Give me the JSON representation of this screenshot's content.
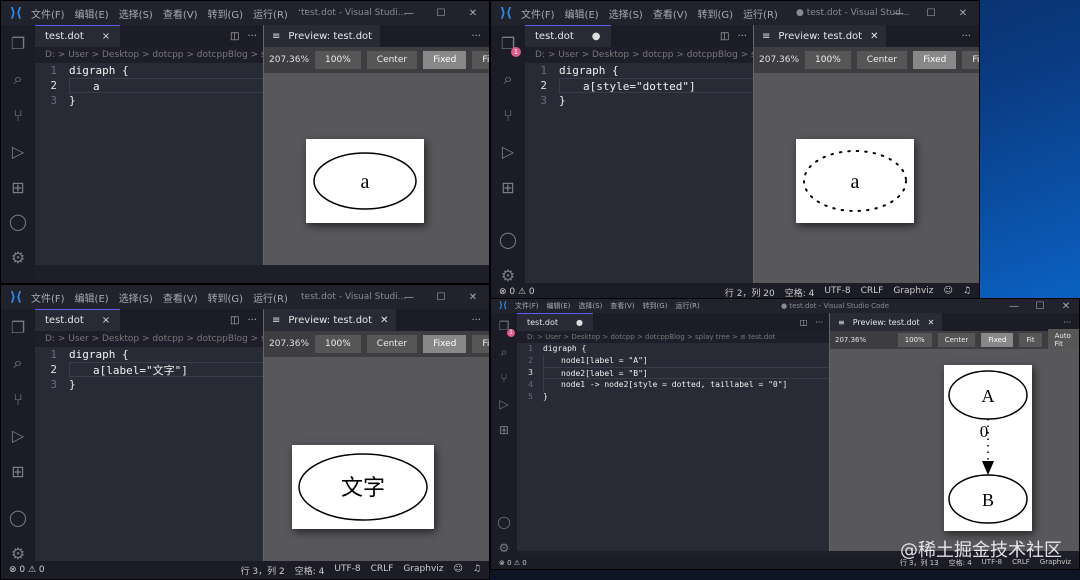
{
  "menu": [
    "文件(F)",
    "编辑(E)",
    "选择(S)",
    "查看(V)",
    "转到(G)",
    "运行(R)",
    "···"
  ],
  "windows": [
    {
      "title": "test.dot - Visual Studi...",
      "tab": "test.dot",
      "tab_status": "×",
      "breadcrumb": "D: > User > Desktop > dotcpp > dotcppBlog > splay tr",
      "code": [
        "digraph {",
        "a",
        "}"
      ],
      "cursor_line": 2,
      "preview_tab": "Preview: test.dot",
      "zoom": "207.36%",
      "buttons": [
        "100%",
        "Center",
        "Fixed",
        "Fit"
      ],
      "node_label": "a",
      "status_left": "",
      "status_right": []
    },
    {
      "title": "● test.dot - Visual Stud...",
      "tab": "test.dot",
      "tab_status": "●",
      "breadcrumb": "D: > User > Desktop > dotcpp > dotcppBlog > splay tr",
      "code": [
        "digraph {",
        "a[style=\"dotted\"]",
        "}"
      ],
      "cursor_line": 2,
      "preview_tab": "Preview: test.dot",
      "zoom": "207.36%",
      "buttons": [
        "100%",
        "Center",
        "Fixed",
        "Fit"
      ],
      "node_label": "a",
      "status_left": "⊗ 0 ⚠ 0",
      "status_right": [
        "行 2，列 20",
        "空格: 4",
        "UTF-8",
        "CRLF",
        "Graphviz"
      ]
    },
    {
      "title": "test.dot - Visual Studi...",
      "tab": "test.dot",
      "tab_status": "×",
      "breadcrumb": "D: > User > Desktop > dotcpp > dotcppBlog > splay tr",
      "code": [
        "digraph {",
        "a[label=\"文字\"]",
        "}"
      ],
      "cursor_line": 2,
      "preview_tab": "Preview: test.dot",
      "zoom": "207.36%",
      "buttons": [
        "100%",
        "Center",
        "Fixed",
        "Fit"
      ],
      "node_label": "文字",
      "status_left": "⊗ 0 ⚠ 0",
      "status_right": [
        "行 3，列 2",
        "空格: 4",
        "UTF-8",
        "CRLF",
        "Graphviz"
      ]
    },
    {
      "title": "● test.dot - Visual Studio Code",
      "tab": "test.dot",
      "tab_status": "●",
      "breadcrumb": "D: > User > Desktop > dotcpp > dotcppBlog > splay tree > ≡ test.dot",
      "code": [
        "digraph {",
        "node1[label = \"A\"]",
        "node2[label = \"B\"]",
        "node1 -> node2[style = dotted, taillabel = \"0\"]",
        "}"
      ],
      "cursor_line": 3,
      "preview_tab": "Preview: test.dot",
      "zoom": "207.36%",
      "buttons": [
        "100%",
        "Center",
        "Fixed",
        "Fit",
        "Auto Fit"
      ],
      "node_a": "A",
      "node_b": "B",
      "edge_label": "0",
      "status_left": "⊗ 0 ⚠ 0",
      "status_right": [
        "行 3，列 13",
        "空格: 4",
        "UTF-8",
        "CRLF",
        "Graphviz"
      ]
    }
  ],
  "watermark": "@稀土掘金技术社区",
  "colors": {
    "accent": "#2b8ff0",
    "editor_bg": "#282a36",
    "preview_bg": "#58585c"
  }
}
